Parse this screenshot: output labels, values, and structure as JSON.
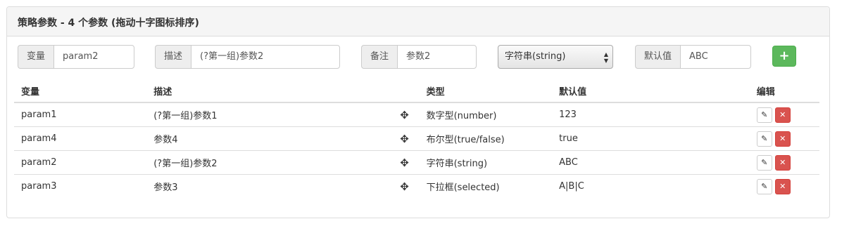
{
  "panel": {
    "title": "策略参数 - 4 个参数 (拖动十字图标排序)"
  },
  "form": {
    "variable_label": "变量",
    "variable_value": "param2",
    "description_label": "描述",
    "description_value": "(?第一组)参数2",
    "remark_label": "备注",
    "remark_value": "参数2",
    "type_selected": "字符串(string)",
    "default_label": "默认值",
    "default_value": "ABC",
    "add_label": "+"
  },
  "table": {
    "headers": {
      "variable": "变量",
      "description": "描述",
      "type": "类型",
      "default": "默认值",
      "edit": "编辑"
    },
    "rows": [
      {
        "variable": "param1",
        "description": "(?第一组)参数1",
        "type": "数字型(number)",
        "default": "123"
      },
      {
        "variable": "param4",
        "description": "参数4",
        "type": "布尔型(true/false)",
        "default": "true"
      },
      {
        "variable": "param2",
        "description": "(?第一组)参数2",
        "type": "字符串(string)",
        "default": "ABC"
      },
      {
        "variable": "param3",
        "description": "参数3",
        "type": "下拉框(selected)",
        "default": "A|B|C"
      }
    ]
  },
  "colors": {
    "add_button": "#5cb85c",
    "delete_button": "#d9534f"
  },
  "icons": {
    "move": "move-icon",
    "edit": "pencil-icon",
    "delete": "close-icon"
  }
}
